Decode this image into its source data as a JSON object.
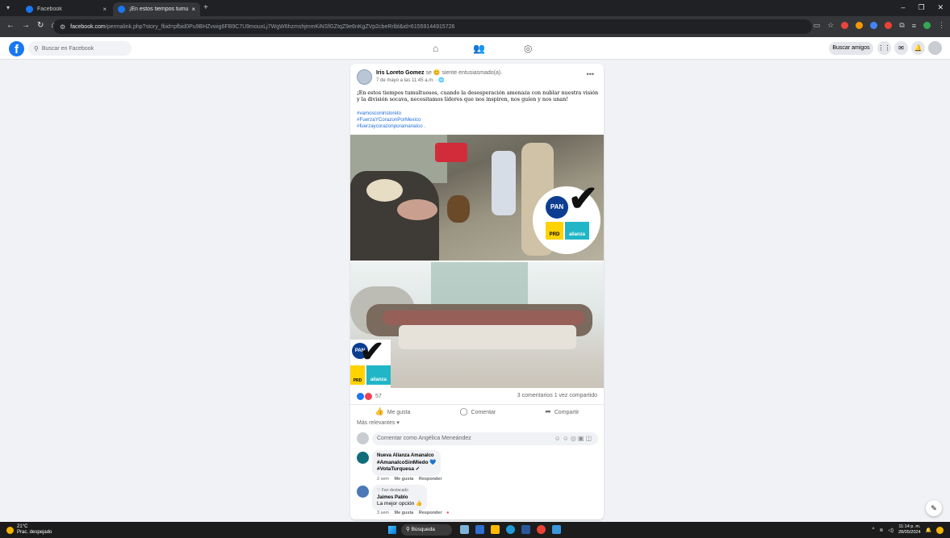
{
  "browser": {
    "tabs": [
      {
        "label": "Facebook"
      },
      {
        "label": "¡En estos tiempos tumult..."
      }
    ],
    "url": {
      "host": "facebook.com",
      "path": "/permalink.php?story_fbid=pfbid0Pu9BHZvwig6FB9C7U9mouxLj7WgW6hzmshjmmKiNSfGZtqZ9e6nKgZVp2cbeRrlbl&id=61559144915726"
    }
  },
  "facebook": {
    "search_placeholder": "Buscar en Facebook",
    "find_friends": "Buscar amigos"
  },
  "post": {
    "author": "Iris Loreto Gomez",
    "feeling": "se 😊 siente entusiasmado(a).",
    "time": "7 de mayo a las 11:45 a.m. · 🌐",
    "text": "¡En estos tiempos tumultuosos, cuando la desesperación amenaza con nublar nuestra visión y la división socava, necesitamos líderes que nos inspiren, nos guíen y nos unan!",
    "hashtags": [
      "#vamosconirisloreto",
      "#FuerzaYCorazonPorMexico",
      "#fuerzaycorazonporamanalco ."
    ],
    "badge_labels": {
      "pan": "PAN",
      "prd": "PRD",
      "alianza": "alianza"
    },
    "reaction_count": "57",
    "stats": "3 comentarios   1 vez compartido",
    "actions": {
      "like": "Me gusta",
      "comment": "Comentar",
      "share": "Compartir"
    },
    "sort_label": "Más relevantes ▾",
    "comment_placeholder": "Comentar como Angélica Meneández"
  },
  "comments": [
    {
      "name": "Nueva Alianza Amanalco",
      "lines": [
        "#AmanalcoSinMiedo 💙",
        "#VotaTurquesa ✓"
      ],
      "meta_time": "2 sem",
      "meta_like": "Me gusta",
      "meta_reply": "Responder",
      "avatar_color": "#0f6c7a"
    },
    {
      "fan_label": "♡ Fan destacado",
      "name": "Jaimes Pablo",
      "lines": [
        "La mejor opción 👍"
      ],
      "meta_time": "3 sem",
      "meta_like": "Me gusta",
      "meta_reply": "Responder",
      "avatar_color": "#4a78b8"
    }
  ],
  "taskbar": {
    "temperature": "21°C",
    "weather": "Prac. despejado",
    "search": "Búsqueda",
    "time": "11:14 p. m.",
    "date": "28/05/2024"
  },
  "colors": {
    "facebook_blue": "#1877f2",
    "page_bg": "#f0f2f5",
    "taskbar": "#1c1c1c"
  }
}
